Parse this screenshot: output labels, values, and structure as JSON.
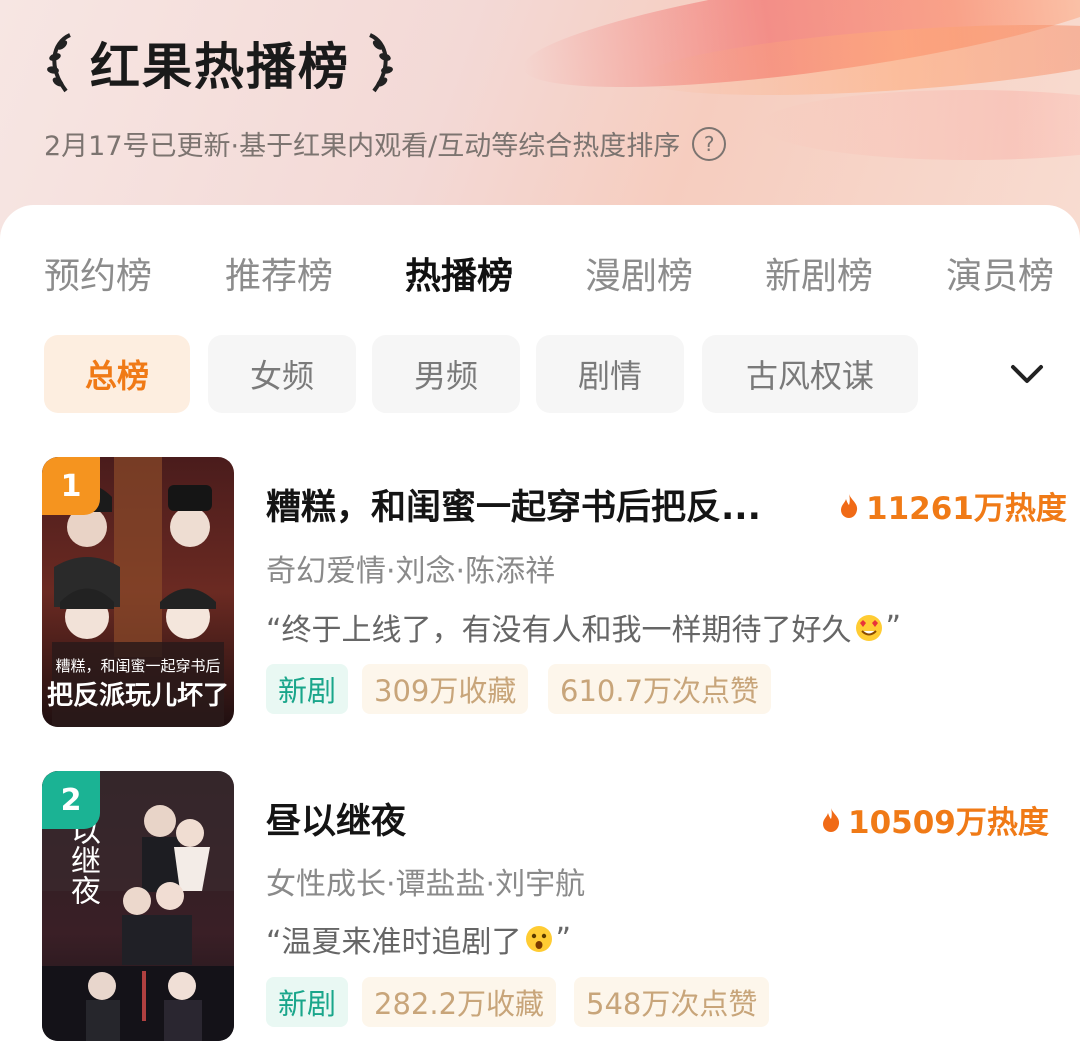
{
  "header": {
    "title": "红果热播榜",
    "subtitle": "2月17号已更新·基于红果内观看/互动等综合热度排序",
    "help_icon": "question-circle-icon"
  },
  "tabs": [
    "预约榜",
    "推荐榜",
    "热播榜",
    "漫剧榜",
    "新剧榜",
    "演员榜"
  ],
  "active_tab": "热播榜",
  "filters": [
    "总榜",
    "女频",
    "男频",
    "剧情",
    "古风权谋"
  ],
  "active_filter": "总榜",
  "expand_icon": "chevron-down-icon",
  "colors": {
    "accent": "#f07a16",
    "new_tag_text": "#1aa68b",
    "stat_tag_text": "#c8a57a",
    "rank1_badge": "#f5941f",
    "rank2_badge": "#1bb394"
  },
  "list": [
    {
      "rank": "1",
      "title": "糟糕，和闺蜜一起穿书后把反...",
      "heat": "11261万热度",
      "meta": "奇幻爱情·刘念·陈添祥",
      "quote_before": "“终于上线了，有没有人和我一样期待了好久",
      "quote_after": "”",
      "emoji": "heart-eyes-emoji",
      "tags": [
        "新剧",
        "309万收藏",
        "610.7万次点赞"
      ],
      "poster_title": "把反派玩儿坏了",
      "poster_subtitle": "糟糕，和闺蜜一起穿书后"
    },
    {
      "rank": "2",
      "title": "昼以继夜",
      "heat": "10509万热度",
      "meta": "女性成长·谭盐盐·刘宇航",
      "quote_before": "“温夏来准时追剧了",
      "quote_after": "”",
      "emoji": "surprised-emoji",
      "tags": [
        "新剧",
        "282.2万收藏",
        "548万次点赞"
      ],
      "poster_title": "以继夜"
    }
  ]
}
